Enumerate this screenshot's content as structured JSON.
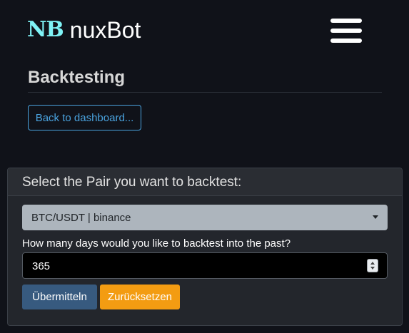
{
  "navbar": {
    "logo_text": "NB",
    "brand_name": "nuxBot",
    "menu_icon": "hamburger-menu-icon"
  },
  "page": {
    "title": "Backtesting",
    "back_button_label": "Back to dashboard..."
  },
  "backtest_form": {
    "header": "Select the Pair you want to backtest:",
    "pair_select": {
      "selected": "BTC/USDT | binance"
    },
    "days_label": "How many days would you like to backtest into the past?",
    "days_value": "365",
    "submit_label": "Übermitteln",
    "reset_label": "Zurücksetzen"
  },
  "colors": {
    "background": "#101219",
    "brand_logo": "#7ff3f6",
    "outline_button": "#4aa3df",
    "card_background": "#23262c",
    "select_background": "#adb5bd",
    "input_background": "#000000",
    "submit_button": "#375a7f",
    "reset_button": "#f39c12"
  }
}
